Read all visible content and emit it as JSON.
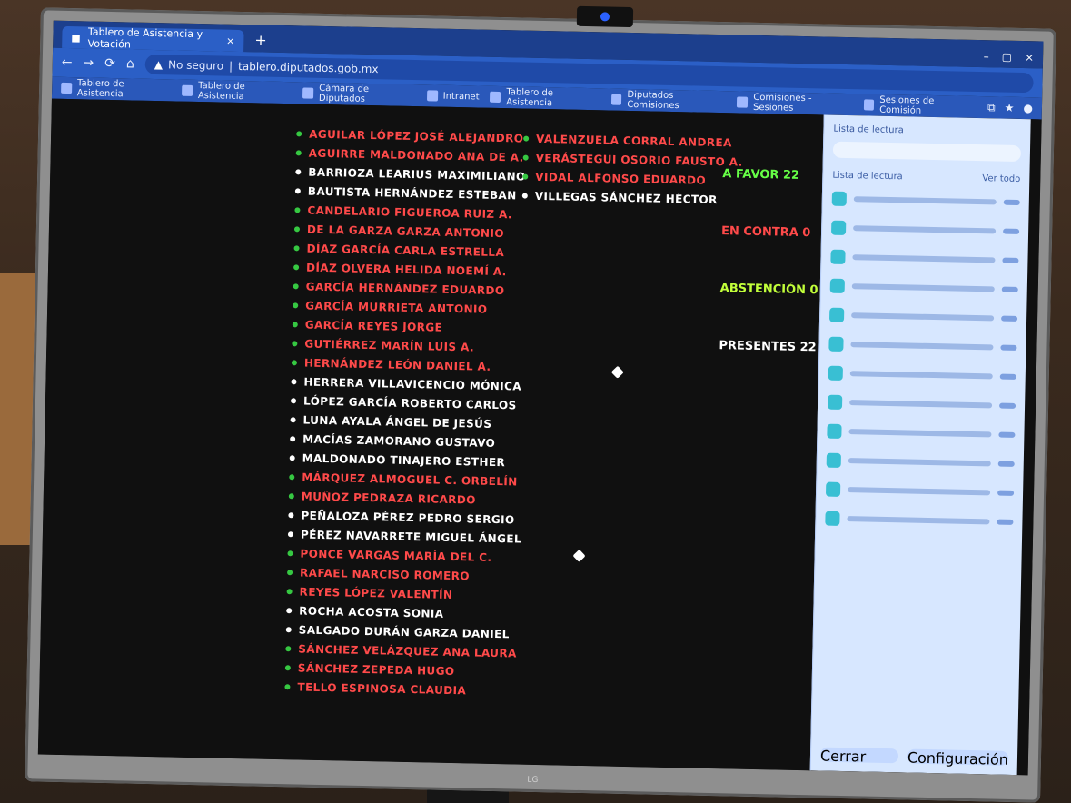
{
  "tab": {
    "title": "Tablero de Asistencia y Votación",
    "close": "×",
    "new_tab": "+"
  },
  "window": {
    "minimize": "–",
    "maximize": "▢",
    "close": "×"
  },
  "address": {
    "security": "No seguro",
    "url": "tablero.diputados.gob.mx"
  },
  "bookmarks": [
    "Tablero de Asistencia",
    "Tablero de Asistencia",
    "Cámara de Diputados",
    "Intranet",
    "Tablero de Asistencia",
    "Diputados Comisiones",
    "Comisiones - Sesiones",
    "Sesiones de Comisión"
  ],
  "members_left": [
    {
      "name": "AGUILAR LÓPEZ JOSÉ ALEJANDRO",
      "color": "red",
      "dot": "green"
    },
    {
      "name": "AGUIRRE MALDONADO ANA DE A.",
      "color": "red",
      "dot": "green"
    },
    {
      "name": "BARRIOZA LEARIUS MAXIMILIANO",
      "color": "white",
      "dot": "white"
    },
    {
      "name": "BAUTISTA HERNÁNDEZ ESTEBAN",
      "color": "white",
      "dot": "white"
    },
    {
      "name": "CANDELARIO FIGUEROA RUIZ A.",
      "color": "red",
      "dot": "green"
    },
    {
      "name": "DE LA GARZA GARZA ANTONIO",
      "color": "red",
      "dot": "green"
    },
    {
      "name": "DÍAZ GARCÍA CARLA ESTRELLA",
      "color": "red",
      "dot": "green"
    },
    {
      "name": "DÍAZ OLVERA HELIDA NOEMÍ A.",
      "color": "red",
      "dot": "green"
    },
    {
      "name": "GARCÍA HERNÁNDEZ EDUARDO",
      "color": "red",
      "dot": "green"
    },
    {
      "name": "GARCÍA MURRIETA ANTONIO",
      "color": "red",
      "dot": "green"
    },
    {
      "name": "GARCÍA REYES JORGE",
      "color": "red",
      "dot": "green"
    },
    {
      "name": "GUTIÉRREZ MARÍN LUIS A.",
      "color": "red",
      "dot": "green"
    },
    {
      "name": "HERNÁNDEZ LEÓN DANIEL A.",
      "color": "red",
      "dot": "green"
    },
    {
      "name": "HERRERA VILLAVICENCIO MÓNICA",
      "color": "white",
      "dot": "white"
    },
    {
      "name": "LÓPEZ GARCÍA ROBERTO CARLOS",
      "color": "white",
      "dot": "white"
    },
    {
      "name": "LUNA AYALA ÁNGEL DE JESÚS",
      "color": "white",
      "dot": "white"
    },
    {
      "name": "MACÍAS ZAMORANO GUSTAVO",
      "color": "white",
      "dot": "white"
    },
    {
      "name": "MALDONADO TINAJERO ESTHER",
      "color": "white",
      "dot": "white"
    },
    {
      "name": "MÁRQUEZ ALMOGUEL C. ORBELÍN",
      "color": "red",
      "dot": "green"
    },
    {
      "name": "MUÑOZ PEDRAZA RICARDO",
      "color": "red",
      "dot": "green"
    },
    {
      "name": "PEÑALOZA PÉREZ PEDRO SERGIO",
      "color": "white",
      "dot": "white"
    },
    {
      "name": "PÉREZ NAVARRETE MIGUEL ÁNGEL",
      "color": "white",
      "dot": "white"
    },
    {
      "name": "PONCE VARGAS MARÍA DEL C.",
      "color": "red",
      "dot": "green"
    },
    {
      "name": "RAFAEL NARCISO ROMERO",
      "color": "red",
      "dot": "green"
    },
    {
      "name": "REYES LÓPEZ VALENTÍN",
      "color": "red",
      "dot": "green"
    },
    {
      "name": "ROCHA ACOSTA SONIA",
      "color": "white",
      "dot": "white"
    },
    {
      "name": "SALGADO DURÁN GARZA DANIEL",
      "color": "white",
      "dot": "white"
    },
    {
      "name": "SÁNCHEZ VELÁZQUEZ ANA LAURA",
      "color": "red",
      "dot": "green"
    },
    {
      "name": "SÁNCHEZ ZEPEDA HUGO",
      "color": "red",
      "dot": "green"
    },
    {
      "name": "TELLO ESPINOSA CLAUDIA",
      "color": "red",
      "dot": "green"
    }
  ],
  "members_mid": [
    {
      "name": "VALENZUELA CORRAL ANDREA",
      "color": "red",
      "dot": "green"
    },
    {
      "name": "VERÁSTEGUI OSORIO FAUSTO A.",
      "color": "red",
      "dot": "green"
    },
    {
      "name": "VIDAL ALFONSO EDUARDO",
      "color": "red",
      "dot": "green"
    },
    {
      "name": "VILLEGAS SÁNCHEZ HÉCTOR",
      "color": "white",
      "dot": "white"
    }
  ],
  "counts": {
    "a_favor": "A FAVOR 22",
    "en_contra": "EN CONTRA 0",
    "abstencion": "ABSTENCIÓN 0",
    "presentes": "PRESENTES 22"
  },
  "panel": {
    "title": "Lista de lectura",
    "header_left": "Lista de lectura",
    "header_right": "Ver todo",
    "items_count": 12,
    "footer_left": "Cerrar",
    "footer_right": "Configuración"
  },
  "icons": {
    "back": "←",
    "forward": "→",
    "reload": "⟳",
    "home": "⌂",
    "warn": "▲"
  },
  "colors": {
    "red_name": "#ff4a4a",
    "white_name": "#ffffff",
    "green_dot": "#36c842",
    "chrome_blue": "#2b5fc6"
  }
}
